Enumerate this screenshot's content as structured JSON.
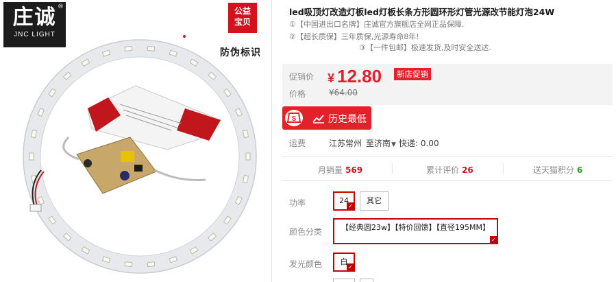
{
  "image": {
    "brand_cn": "庄诚",
    "brand_en": "JNC LIGHT",
    "brand_reg": "®",
    "charity_line1": "公益",
    "charity_line2": "宝贝",
    "anti_fake": "防伪标识"
  },
  "product": {
    "title": "led吸顶灯改造灯板led灯板长条方形圆环形灯管光源改节能灯泡24W",
    "promos": [
      "①【中国进出口名牌】庄诚官方旗舰店全网正品保障.",
      "②【超长质保】三年质保,光源寿命8年!",
      "③【一件包邮】极速发货,及时安全送达."
    ]
  },
  "price": {
    "label": "促销价",
    "currency": "¥",
    "amount": "12.80",
    "badge": "新店促销",
    "original_label": "价格",
    "original_value": "¥64.00"
  },
  "history_button": {
    "label": "历史最低"
  },
  "shipping": {
    "label": "运费",
    "origin": "江苏常州",
    "destination": "至济南",
    "fee": "快递: 0.00"
  },
  "stats": [
    {
      "label": "月销量",
      "value": "569"
    },
    {
      "label": "累计评价",
      "value": "26"
    },
    {
      "label": "送天猫积分",
      "value": "6"
    }
  ],
  "options": {
    "power_label": "功率",
    "power_values": [
      "24",
      "其它"
    ],
    "color_label": "颜色分类",
    "color_value": "【经典圆23w】【特价回馈】【直径195MM】",
    "light_label": "发光颜色",
    "light_value": "白"
  },
  "colors": {
    "accent_red": "#e4202a",
    "selected_border": "#c40000",
    "stat_green": "#2a9a2a"
  }
}
